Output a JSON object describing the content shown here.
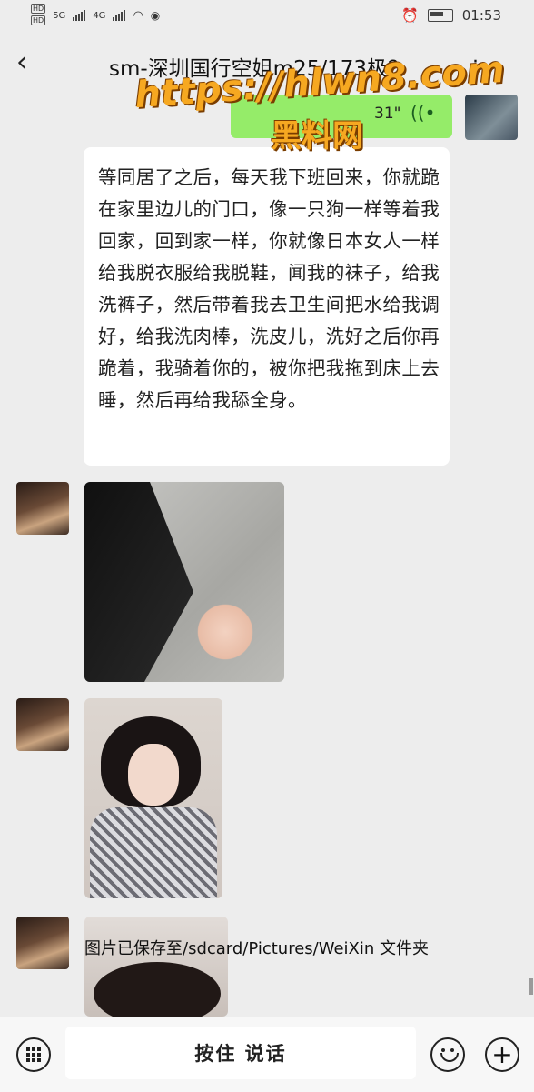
{
  "status_bar": {
    "hd1": "HD",
    "hd2": "HD",
    "net1": "5G",
    "net2": "4G",
    "time": "01:53"
  },
  "header": {
    "back_icon": "chevron-left-icon",
    "title": "sm-深圳国行空姐m25/173极？",
    "more_label": "·"
  },
  "watermark": {
    "url": "https://hlwn8.com",
    "name": "黑料网"
  },
  "voice_message": {
    "duration": "31\"",
    "icon": "voice-wave-icon"
  },
  "text_message": {
    "content": "等同居了之后，每天我下班回来，你就跪在家里边儿的门口，像一只狗一样等着我回家，回到家一样，你就像日本女人一样给我脱衣服给我脱鞋，闻我的袜子，给我洗裤子，然后带着我去卫生间把水给我调好，给我洗肉棒，洗皮儿，洗好之后你再跪着，我骑着你的，被你把我拖到床上去睡，然后再给我舔全身。"
  },
  "toast": {
    "text": "图片已保存至/sdcard/Pictures/WeiXin 文件夹"
  },
  "input_bar": {
    "keyboard_icon": "keyboard-icon",
    "hold_to_talk": "按住 说话",
    "emoji_icon": "emoji-icon",
    "plus_label": "+"
  }
}
